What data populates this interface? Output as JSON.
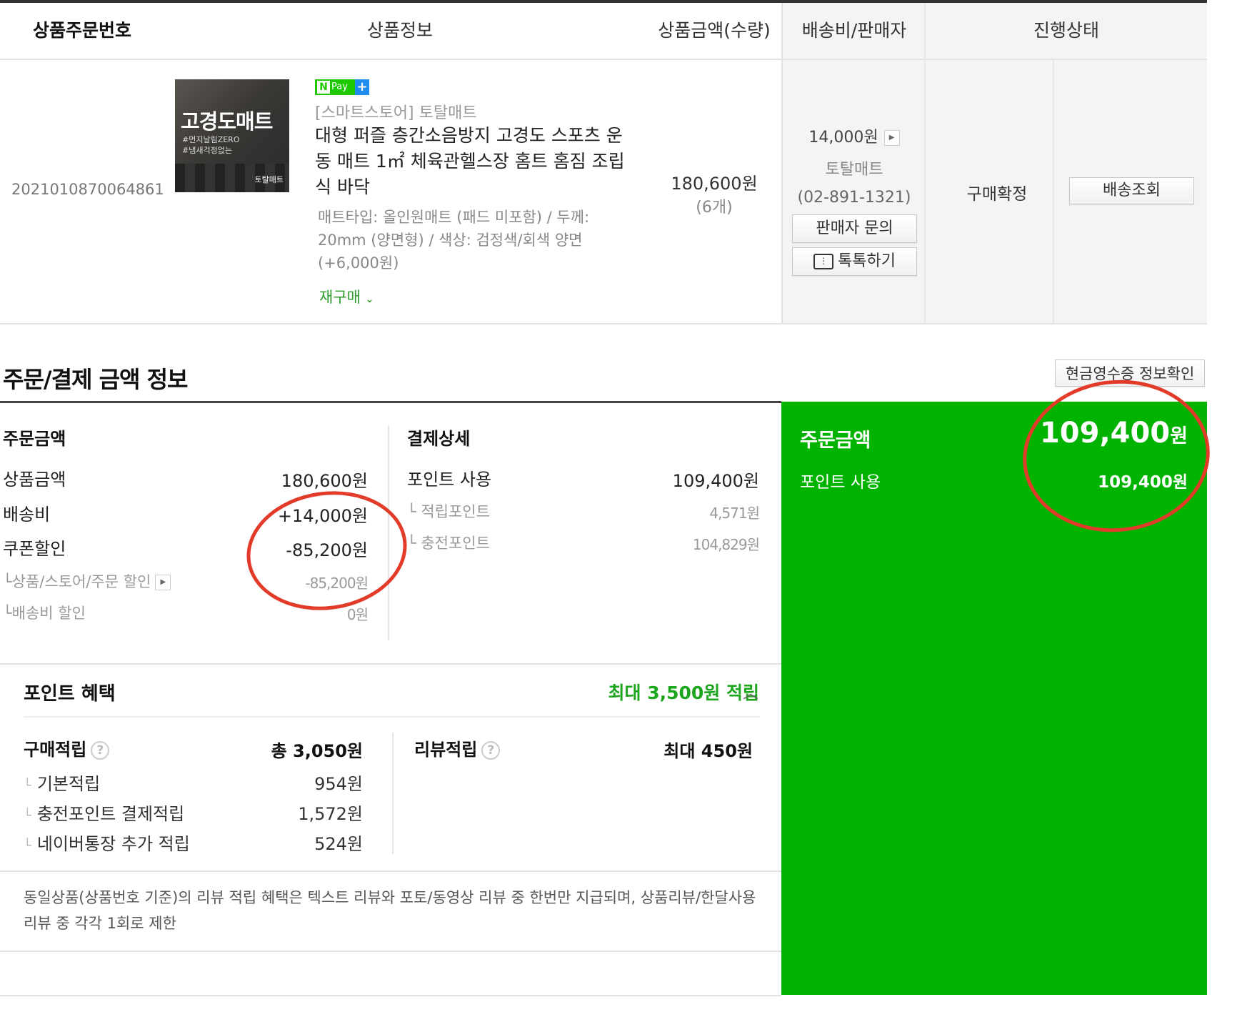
{
  "table": {
    "headers": {
      "order_no": "상품주문번호",
      "product_info": "상품정보",
      "price_qty": "상품금액(수량)",
      "ship_seller": "배송비/판매자",
      "status": "진행상태"
    },
    "row": {
      "order_no": "2021010870064861",
      "thumb_title": "고경도매트",
      "thumb_sub1": "#먼지날림ZERO",
      "thumb_sub2": "#냄새걱정없는",
      "thumb_logo": "토탈매트",
      "npay_n": "N",
      "npay_label": "Pay",
      "npay_plus": "+",
      "store": "[스마트스토어] 토탈매트",
      "title": "대형 퍼즐 층간소음방지 고경도 스포츠 운동 매트 1㎡ 체육관헬스장 홈트 홈짐 조립식 바닥",
      "options": "매트타입: 올인원매트 (패드 미포함) / 두께: 20mm (양면형) / 색상: 검정색/회색 양면 (+6,000원)",
      "rebuy": "재구매",
      "price": "180,600원",
      "qty": "(6개)",
      "shipping_fee": "14,000원",
      "seller": "토탈매트",
      "seller_tel": "(02-891-1321)",
      "inquiry_btn": "판매자 문의",
      "talk_btn": "톡톡하기",
      "status": "구매확정",
      "tracking_btn": "배송조회"
    }
  },
  "payment": {
    "section_title": "주문/결제 금액 정보",
    "cash_receipt_btn": "현금영수증 정보확인",
    "order": {
      "title": "주문금액",
      "items": [
        {
          "label": "상품금액",
          "value": "180,600원"
        },
        {
          "label": "배송비",
          "value": "+14,000원"
        },
        {
          "label": "쿠폰할인",
          "value": "-85,200원"
        }
      ],
      "sub_items": [
        {
          "label": "상품/스토어/주문 할인",
          "value": "-85,200원"
        },
        {
          "label": "배송비 할인",
          "value": "0원"
        }
      ]
    },
    "detail": {
      "title": "결제상세",
      "point_label": "포인트 사용",
      "point_value": "109,400원",
      "sub_items": [
        {
          "label": "적립포인트",
          "value": "4,571원"
        },
        {
          "label": "충전포인트",
          "value": "104,829원"
        }
      ]
    },
    "summary": {
      "title": "주문금액",
      "amount": "109,400",
      "amount_unit": "원",
      "point_label": "포인트 사용",
      "point_value": "109,400원"
    }
  },
  "benefit": {
    "title": "포인트 혜택",
    "max": "최대 3,500원 적립",
    "purchase": {
      "label": "구매적립",
      "total": "총 3,050원",
      "items": [
        {
          "label": "기본적립",
          "value": "954원"
        },
        {
          "label": "충전포인트 결제적립",
          "value": "1,572원"
        },
        {
          "label": "네이버통장 추가 적립",
          "value": "524원"
        }
      ]
    },
    "review": {
      "label": "리뷰적립",
      "value": "최대 450원"
    },
    "notice": "동일상품(상품번호 기준)의 리뷰 적립 혜택은 텍스트 리뷰와 포토/동영상 리뷰 중 한번만 지급되며, 상품리뷰/한달사용 리뷰 중 각각 1회로 제한"
  },
  "colors": {
    "green_panel": "#00b300",
    "annotation_red": "#e23b2a",
    "rebuy_green": "#2c9b2c"
  }
}
